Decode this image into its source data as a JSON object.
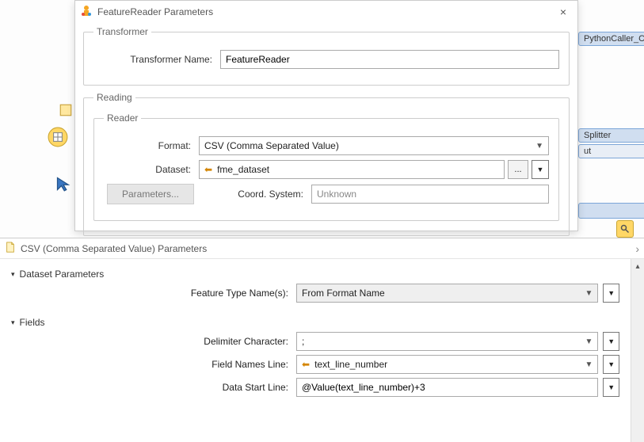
{
  "dialog1": {
    "title": "FeatureReader Parameters",
    "transformer_group": "Transformer",
    "transformer_name_label": "Transformer Name:",
    "transformer_name_value": "FeatureReader",
    "reading_group": "Reading",
    "reader_group": "Reader",
    "format_label": "Format:",
    "format_value": "CSV (Comma Separated Value)",
    "dataset_label": "Dataset:",
    "dataset_value": "fme_dataset",
    "browse_ellipsis": "...",
    "parameters_btn": "Parameters...",
    "coord_label": "Coord. System:",
    "coord_value": "Unknown"
  },
  "dialog2": {
    "title": "CSV (Comma Separated Value) Parameters",
    "dataset_params_header": "Dataset Parameters",
    "feature_type_label": "Feature Type Name(s):",
    "feature_type_value": "From Format Name",
    "fields_header": "Fields",
    "delimiter_label": "Delimiter Character:",
    "delimiter_value": ";",
    "field_names_line_label": "Field Names Line:",
    "field_names_line_value": "text_line_number",
    "data_start_line_label": "Data Start Line:",
    "data_start_line_value": "@Value(text_line_number)+3"
  },
  "canvas": {
    "node1": "PythonCaller_C",
    "node2": "Splitter",
    "node2_sub": "ut"
  }
}
